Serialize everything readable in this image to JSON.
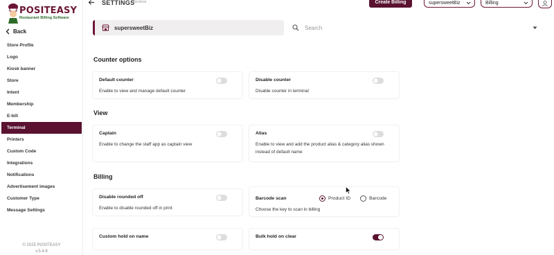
{
  "app": {
    "logo_text": "POSITEASY",
    "logo_subtitle": "Restaurant Billing Software",
    "copyright": "© 2025 POSITEASY",
    "version": "v.5.4.8"
  },
  "sidebar": {
    "back_label": "Back",
    "items": [
      {
        "label": "Store Profile"
      },
      {
        "label": "Logo"
      },
      {
        "label": "Kiosk banner"
      },
      {
        "label": "Store"
      },
      {
        "label": "Intent"
      },
      {
        "label": "Membership"
      },
      {
        "label": "E-bill"
      },
      {
        "label": "Terminal"
      },
      {
        "label": "Printers"
      },
      {
        "label": "Custom Code"
      },
      {
        "label": "Integrations"
      },
      {
        "label": "Notifications"
      },
      {
        "label": "Advertisement images"
      },
      {
        "label": "Customer Type"
      },
      {
        "label": "Message Settings"
      }
    ],
    "active_index": 7
  },
  "header": {
    "title": "SETTINGS",
    "subtitle": "Terminal",
    "create_billing_label": "Create Billing",
    "store_select_value": "supersweetBiz",
    "mode_select_value": "Billing"
  },
  "store_bar": {
    "store_name": "supersweetBiz",
    "search_placeholder": "Search"
  },
  "sections": {
    "counter": {
      "title": "Counter options",
      "default_counter": {
        "title": "Default counter",
        "desc": "Enable to view and manage default counter",
        "enabled": false
      },
      "disable_counter": {
        "title": "Disable counter",
        "desc": "Disable counter in terminal",
        "enabled": false
      }
    },
    "view": {
      "title": "View",
      "captain": {
        "title": "Captain",
        "desc": "Enable to change the staff app as captain view",
        "enabled": false
      },
      "alias": {
        "title": "Alias",
        "desc": "Enable to view and add the product alias & category alias shown instead of default name",
        "enabled": false
      }
    },
    "billing": {
      "title": "Billing",
      "rounded_off": {
        "title": "Disable rounded off",
        "desc": "Enable to disable rounded off in print",
        "enabled": false
      },
      "barcode_scan": {
        "title": "Barcode scan",
        "desc": "Choose the key to scan in billing",
        "option_1": "Product ID",
        "option_2": "Barcode",
        "selected": "Product ID"
      },
      "custom_hold": {
        "title": "Custom hold on name",
        "enabled": false
      },
      "bulk_hold": {
        "title": "Bulk hold on clear",
        "enabled": true
      }
    }
  },
  "colors": {
    "brand": "#5a1230",
    "toggle_off": "#dddddd"
  }
}
